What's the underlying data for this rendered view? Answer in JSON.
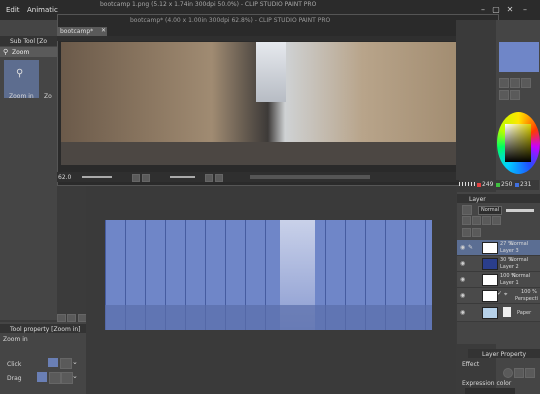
{
  "app": {
    "window_title": "bootcamp 1.png (5.12 x 1.74in 300dpi 50.0%) - CLIP STUDIO PAINT PRO",
    "second_title": "bootcamp* (4.00 x 1.00in 300dpi 62.8%) - CLIP STUDIO PAINT PRO",
    "menu": [
      "Edit",
      "Animatic"
    ]
  },
  "sub_tool": {
    "header": "Sub Tool [Zo",
    "tab_label": "Zoom",
    "tools": [
      "Zoom in",
      "Zo"
    ]
  },
  "tool_property": {
    "header": "Tool property [Zoom in]",
    "title": "Zoom in",
    "rows": [
      {
        "label": "Click"
      },
      {
        "label": "Drag"
      }
    ]
  },
  "document": {
    "tab_label": "bootcamp*",
    "zoom": "62.0"
  },
  "color": {
    "hsv": [
      "249",
      "250",
      "231"
    ]
  },
  "layer_panel": {
    "header": "Layer",
    "blend_mode": "Normal",
    "layers": [
      {
        "opacity": "27 %",
        "mode": "Normal",
        "name": "Layer 3",
        "selected": true
      },
      {
        "opacity": "30 %",
        "mode": "Normal",
        "name": "Layer 2",
        "selected": false
      },
      {
        "opacity": "100 %",
        "mode": "Normal",
        "name": "Layer 1",
        "selected": false
      },
      {
        "opacity": "100 %",
        "mode": "",
        "name": "Perspecti",
        "selected": false
      },
      {
        "opacity": "",
        "mode": "",
        "name": "Paper",
        "selected": false
      }
    ]
  },
  "layer_property": {
    "header": "Layer Property",
    "effect_label": "Effect",
    "expression_label": "Expression color"
  }
}
